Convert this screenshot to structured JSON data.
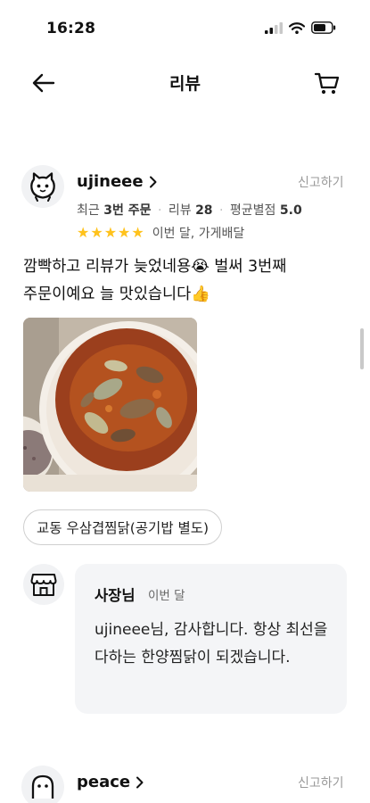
{
  "status_bar": {
    "time": "16:28"
  },
  "nav": {
    "title": "리뷰",
    "back_icon": "arrow-left-icon",
    "cart_icon": "cart-icon"
  },
  "reviews": [
    {
      "username": "ujineee",
      "report_label": "신고하기",
      "meta": {
        "orders_prefix": "최근",
        "orders_value": "3번 주문",
        "reviews_label": "리뷰",
        "reviews_value": "28",
        "avg_label": "평균별점",
        "avg_value": "5.0"
      },
      "rating": 5,
      "stars_meta": "이번 달, 가게배달",
      "text": "깜빡하고 리뷰가 늦었네용😭 벌써 3번째 주문이예요 늘 맛있습니다👍",
      "menu_chip": "교동 우삼겹찜닭(공기밥 별도)",
      "owner_reply": {
        "name": "사장님",
        "when": "이번 달",
        "text": "ujineee님,  감사합니다. 항상 최선을 다하는 한양찜닭이 되겠습니다."
      }
    },
    {
      "username": "peace",
      "report_label": "신고하기"
    }
  ],
  "colors": {
    "star": "#ffc21c",
    "bubble": "#f4f5f7",
    "muted": "#9a9a9a"
  }
}
